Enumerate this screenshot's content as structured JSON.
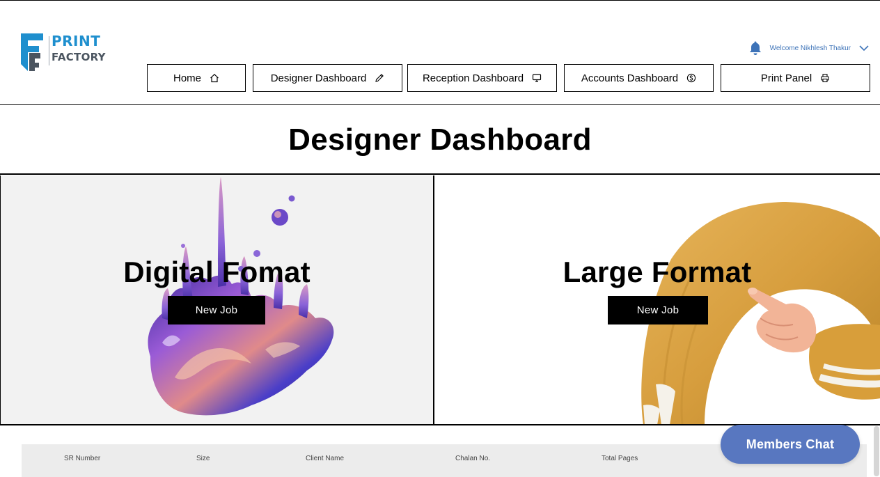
{
  "brand": {
    "line1": "PRINT",
    "line2": "FACTORY",
    "accent": "#1f8fce",
    "secondary": "#4b5560"
  },
  "user": {
    "welcome_text": "Welcome Nikhlesh Thakur",
    "notification_icon": "bell-icon",
    "menu_icon": "chevron-down-icon"
  },
  "nav": [
    {
      "label": "Home",
      "icon": "home-icon"
    },
    {
      "label": "Designer Dashboard",
      "icon": "pencil-icon"
    },
    {
      "label": "Reception Dashboard",
      "icon": "monitor-icon"
    },
    {
      "label": "Accounts Dashboard",
      "icon": "dollar-coin-icon"
    },
    {
      "label": "Print Panel",
      "icon": "printer-icon"
    }
  ],
  "page": {
    "title": "Designer Dashboard"
  },
  "panels": [
    {
      "heading": "Digital Fomat",
      "button_label": "New Job"
    },
    {
      "heading": "Large Format",
      "button_label": "New Job"
    }
  ],
  "table": {
    "columns": [
      "SR Number",
      "Size",
      "Client Name",
      "Chalan No.",
      "Total Pages"
    ]
  },
  "chat": {
    "label": "Members Chat",
    "color": "#5877c0"
  }
}
